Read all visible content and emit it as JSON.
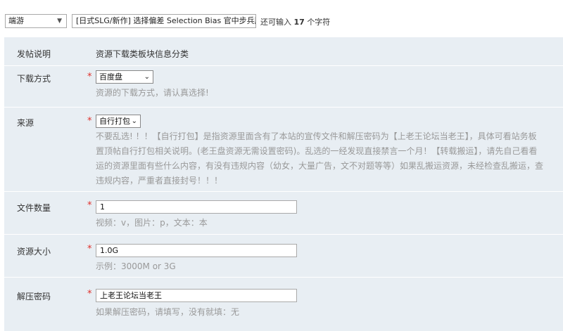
{
  "topbar": {
    "category_value": "端游",
    "title_value": "[日式SLG/新作] 选择偏差 Selection Bias 官中步兵版",
    "remain_prefix": "还可输入",
    "remain_count": "17",
    "remain_suffix": "个字符"
  },
  "form": {
    "intro": {
      "label": "发帖说明",
      "text": "资源下载类板块信息分类"
    },
    "download": {
      "label": "下载方式",
      "selected": "百度盘",
      "hint": "资源的下载方式，请认真选择!"
    },
    "source": {
      "label": "来源",
      "selected": "自行打包",
      "hint_lines": [
        "不要乱选! ！！【自行打包】是指资源里面含有了本站的宣传文件和解压密码为【上老王论坛当老王】，具体可看站务板",
        "置顶帖自行打包相关说明。(老王盘资源无需设置密码)。乱选的一经发现直接禁言一个月！【转载搬运】，请先自己看看",
        "运的资源里面有些什么内容，有没有违规内容（幼女，大量广告，文不对题等等）如果乱搬运资源，未经检查乱搬运，查",
        "违规内容，严重者直接封号！！！"
      ]
    },
    "file_count": {
      "label": "文件数量",
      "value": "1",
      "hint": "视频：v，图片：p，文本：本"
    },
    "size": {
      "label": "资源大小",
      "value": "1.0G",
      "hint": "示例：3000M or 3G"
    },
    "password": {
      "label": "解压密码",
      "value": "上老王论坛当老王",
      "hint": "如果解压密码，请填写，没有就填：无"
    }
  },
  "required_mark": "*"
}
